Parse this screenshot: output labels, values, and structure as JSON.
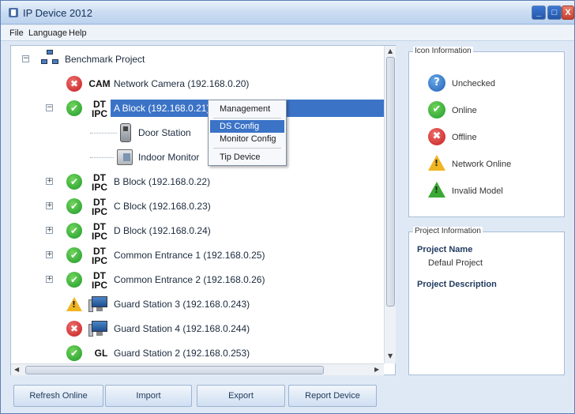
{
  "window": {
    "title": "IP Device 2012",
    "controls": {
      "minimize": "_",
      "maximize": "□",
      "close": "X"
    }
  },
  "menu": {
    "file": "File",
    "language": "Language",
    "help": "Help"
  },
  "tree": {
    "root": {
      "label": "Benchmark Project",
      "expander": "−"
    },
    "rows": [
      {
        "status": "offline",
        "tag": "CAM",
        "label": "Network Camera (192.168.0.20)"
      },
      {
        "status": "online",
        "tag_top": "DT",
        "tag_bottom": "IPC",
        "label": "A Block (192.168.0.21)",
        "expander": "−",
        "selected": true
      },
      {
        "label": "Door Station"
      },
      {
        "label": "Indoor Monitor"
      },
      {
        "status": "online",
        "tag_top": "DT",
        "tag_bottom": "IPC",
        "label": "B Block (192.168.0.22)",
        "expander": "+"
      },
      {
        "status": "online",
        "tag_top": "DT",
        "tag_bottom": "IPC",
        "label": "C Block (192.168.0.23)",
        "expander": "+"
      },
      {
        "status": "online",
        "tag_top": "DT",
        "tag_bottom": "IPC",
        "label": "D Block (192.168.0.24)",
        "expander": "+"
      },
      {
        "status": "online",
        "tag_top": "DT",
        "tag_bottom": "IPC",
        "label": "Common Entrance 1 (192.168.0.25)",
        "expander": "+"
      },
      {
        "status": "online",
        "tag_top": "DT",
        "tag_bottom": "IPC",
        "label": "Common Entrance 2 (192.168.0.26)",
        "expander": "+"
      },
      {
        "status": "warning",
        "label": "Guard Station 3 (192.168.0.243)"
      },
      {
        "status": "offline",
        "label": "Guard Station 4 (192.168.0.244)"
      },
      {
        "status": "online",
        "tag": "GL",
        "label": "Guard Station 2 (192.168.0.253)"
      }
    ],
    "status_glyphs": {
      "online": "✔",
      "offline": "✖",
      "warning": "!"
    },
    "scroll": {
      "up": "▲",
      "down": "▼",
      "left": "◀",
      "right": "▶"
    }
  },
  "context_menu": {
    "items": [
      "Management",
      "DS Config",
      "Monitor Config",
      "Tip Device"
    ],
    "highlighted": "DS Config"
  },
  "icon_info": {
    "title": "Icon Information",
    "items": [
      {
        "glyph": "?",
        "label": "Unchecked"
      },
      {
        "glyph": "✔",
        "label": "Online"
      },
      {
        "glyph": "✖",
        "label": "Offline"
      },
      {
        "glyph": "!",
        "label": "Network Online"
      },
      {
        "glyph": "!",
        "label": "Invalid Model"
      }
    ]
  },
  "project_info": {
    "title": "Project Information",
    "name_label": "Project Name",
    "name_value": "Defaul Project",
    "description_label": "Project Description"
  },
  "buttons": {
    "refresh": "Refresh Online",
    "import": "Import",
    "export": "Export",
    "report": "Report Device"
  }
}
